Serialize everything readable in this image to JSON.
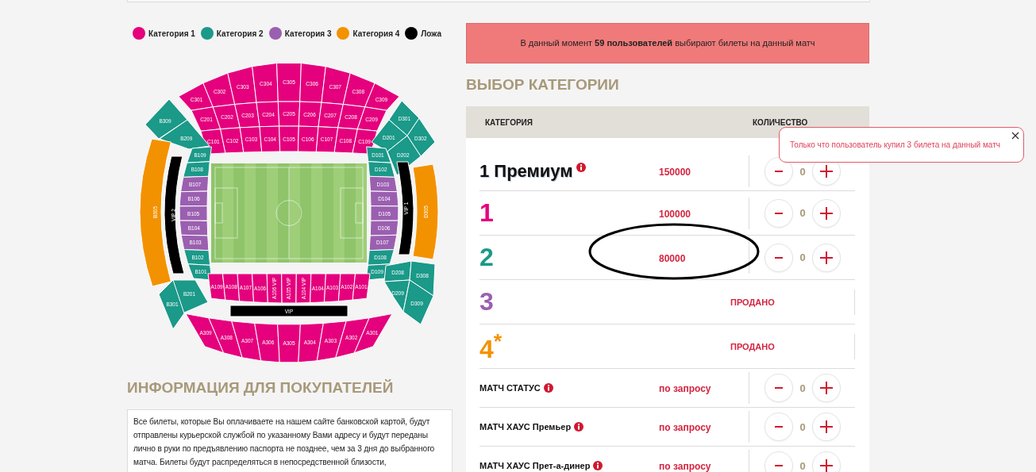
{
  "legend": [
    {
      "label": "Категория 1",
      "color": "#e5007d"
    },
    {
      "label": "Категория 2",
      "color": "#1b9989"
    },
    {
      "label": "Категория 3",
      "color": "#9b5fb0"
    },
    {
      "label": "Категория 4",
      "color": "#f39200"
    },
    {
      "label": "Ложа",
      "color": "#000000"
    }
  ],
  "stadium": {
    "stands": [
      {
        "sections": [
          {
            "label": "C301",
            "color": "#e5007d"
          },
          {
            "label": "C302",
            "color": "#e5007d"
          },
          {
            "label": "C303",
            "color": "#e5007d"
          },
          {
            "label": "C304",
            "color": "#e5007d"
          },
          {
            "label": "C305",
            "color": "#e5007d"
          },
          {
            "label": "C306",
            "color": "#e5007d"
          },
          {
            "label": "C307",
            "color": "#e5007d"
          },
          {
            "label": "C308",
            "color": "#e5007d"
          },
          {
            "label": "C309",
            "color": "#e5007d"
          }
        ]
      },
      {
        "sections": [
          {
            "label": "C201",
            "color": "#e5007d"
          },
          {
            "label": "C202",
            "color": "#e5007d"
          },
          {
            "label": "C203",
            "color": "#e5007d"
          },
          {
            "label": "C204",
            "color": "#e5007d"
          },
          {
            "label": "C205",
            "color": "#e5007d"
          },
          {
            "label": "C206",
            "color": "#e5007d"
          },
          {
            "label": "C207",
            "color": "#e5007d"
          },
          {
            "label": "C208",
            "color": "#e5007d"
          },
          {
            "label": "C209",
            "color": "#e5007d"
          }
        ]
      },
      {
        "sections": [
          {
            "label": "C101",
            "color": "#e5007d"
          },
          {
            "label": "C102",
            "color": "#e5007d"
          },
          {
            "label": "C103",
            "color": "#e5007d"
          },
          {
            "label": "C104",
            "color": "#e5007d"
          },
          {
            "label": "C105",
            "color": "#e5007d"
          },
          {
            "label": "C106",
            "color": "#e5007d"
          },
          {
            "label": "C107",
            "color": "#e5007d"
          },
          {
            "label": "C108",
            "color": "#e5007d"
          },
          {
            "label": "C109",
            "color": "#e5007d"
          }
        ]
      },
      {
        "sections": [
          {
            "label": "B309",
            "color": "#1b9989"
          },
          {
            "label": "B209",
            "color": "#1b9989"
          }
        ]
      },
      {
        "sections": [
          {
            "label": "D301",
            "color": "#1b9989"
          },
          {
            "label": "D201",
            "color": "#1b9989"
          },
          {
            "label": "D302",
            "color": "#1b9989"
          },
          {
            "label": "D202",
            "color": "#1b9989"
          }
        ]
      },
      {
        "sections": [
          {
            "label": "B305",
            "color": "#f39200"
          }
        ]
      },
      {
        "sections": [
          {
            "label": "VIP 2",
            "color": "#000000"
          }
        ]
      },
      {
        "sections": [
          {
            "label": "B109",
            "color": "#1b9989"
          },
          {
            "label": "B108",
            "color": "#1b9989"
          },
          {
            "label": "B107",
            "color": "#9b5fb0"
          },
          {
            "label": "B106",
            "color": "#9b5fb0"
          },
          {
            "label": "B105",
            "color": "#9b5fb0"
          },
          {
            "label": "B104",
            "color": "#9b5fb0"
          },
          {
            "label": "B103",
            "color": "#9b5fb0"
          },
          {
            "label": "B102",
            "color": "#1b9989"
          },
          {
            "label": "B101",
            "color": "#1b9989"
          }
        ]
      },
      {
        "sections": [
          {
            "label": "D101",
            "color": "#1b9989"
          },
          {
            "label": "D102",
            "color": "#1b9989"
          },
          {
            "label": "D103",
            "color": "#9b5fb0"
          },
          {
            "label": "D104",
            "color": "#9b5fb0"
          },
          {
            "label": "D105",
            "color": "#9b5fb0"
          },
          {
            "label": "D106",
            "color": "#9b5fb0"
          },
          {
            "label": "D107",
            "color": "#9b5fb0"
          },
          {
            "label": "D108",
            "color": "#1b9989"
          },
          {
            "label": "D109",
            "color": "#1b9989"
          }
        ]
      },
      {
        "sections": [
          {
            "label": "VIP 1",
            "color": "#000000"
          }
        ]
      },
      {
        "sections": [
          {
            "label": "D305",
            "color": "#f39200"
          }
        ]
      },
      {
        "sections": [
          {
            "label": "B201",
            "color": "#1b9989"
          },
          {
            "label": "B301",
            "color": "#1b9989"
          }
        ]
      },
      {
        "sections": [
          {
            "label": "D208",
            "color": "#1b9989"
          },
          {
            "label": "D308",
            "color": "#1b9989"
          },
          {
            "label": "D209",
            "color": "#1b9989"
          },
          {
            "label": "D309",
            "color": "#1b9989"
          }
        ]
      },
      {
        "sections": [
          {
            "label": "A109",
            "color": "#e5007d"
          },
          {
            "label": "A108",
            "color": "#e5007d"
          },
          {
            "label": "A107",
            "color": "#e5007d"
          },
          {
            "label": "A106",
            "color": "#e5007d"
          },
          {
            "label": "A106 VIP",
            "color": "#e5007d"
          },
          {
            "label": "A105 VIP",
            "color": "#e5007d"
          },
          {
            "label": "A104 VIP",
            "color": "#e5007d"
          },
          {
            "label": "A104",
            "color": "#e5007d"
          },
          {
            "label": "A103",
            "color": "#e5007d"
          },
          {
            "label": "A102",
            "color": "#e5007d"
          },
          {
            "label": "A101",
            "color": "#e5007d"
          }
        ]
      },
      {
        "sections": [
          {
            "label": "VIP",
            "color": "#000000"
          }
        ]
      },
      {
        "sections": [
          {
            "label": "A309",
            "color": "#e5007d"
          },
          {
            "label": "A308",
            "color": "#e5007d"
          },
          {
            "label": "A307",
            "color": "#e5007d"
          },
          {
            "label": "A306",
            "color": "#e5007d"
          },
          {
            "label": "A305",
            "color": "#e5007d"
          },
          {
            "label": "A304",
            "color": "#e5007d"
          },
          {
            "label": "A303",
            "color": "#e5007d"
          },
          {
            "label": "A302",
            "color": "#e5007d"
          },
          {
            "label": "A301",
            "color": "#e5007d"
          }
        ]
      }
    ]
  },
  "info": {
    "title": "ИНФОРМАЦИЯ ДЛЯ ПОКУПАТЕЛЕЙ",
    "text": "Все билеты, которые Вы оплачиваете на нашем сайте банковской картой, будут отправлены курьерской службой по указанному Вами адресу и будут переданы лично в руки по предъявлению паспорта не позднее, чем за 3 дня до выбранного матча. Билеты будут распределяться в непосредственной близости,"
  },
  "banner": "В данный момент **59 пользователей** выбирают билеты на данный матч",
  "selection": {
    "title": "ВЫБОР КАТЕГОРИИ",
    "columns": [
      "КАТЕГОРИЯ",
      "КОЛИЧЕСТВО"
    ],
    "rows": [
      {
        "kind": "premium",
        "name": "1 Премиум",
        "info": true,
        "price": "150000",
        "sold": false,
        "quantity": "0",
        "highlighted": false
      },
      {
        "kind": "category",
        "name": "1",
        "color": "#e5007d",
        "info": false,
        "price": "100000",
        "sold": false,
        "quantity": "0",
        "highlighted": false
      },
      {
        "kind": "category",
        "name": "2",
        "color": "#1b9989",
        "info": false,
        "price": "80000",
        "sold": false,
        "quantity": "0",
        "highlighted": true
      },
      {
        "kind": "category",
        "name": "3",
        "color": "#9b5fb0",
        "info": false,
        "status": "ПРОДАНО",
        "sold": true,
        "highlighted": false
      },
      {
        "kind": "category",
        "name": "4$^{*}$",
        "color": "#f39200",
        "info": false,
        "status": "ПРОДАНО",
        "sold": true,
        "highlighted": false
      },
      {
        "kind": "package",
        "name": "МАТЧ СТАТУС",
        "info": true,
        "price": "по запросу",
        "sold": false,
        "quantity": "0",
        "highlighted": false
      },
      {
        "kind": "package",
        "name": "МАТЧ ХАУС Премьер",
        "info": true,
        "price": "по запросу",
        "sold": false,
        "quantity": "0",
        "highlighted": false
      },
      {
        "kind": "package",
        "name": "МАТЧ ХАУС Прет-а-динер",
        "info": true,
        "price": "по запросу",
        "sold": false,
        "quantity": "0",
        "highlighted": false
      }
    ]
  },
  "notification": {
    "text": "Только что пользователь купил 3 билета на данный матч"
  }
}
